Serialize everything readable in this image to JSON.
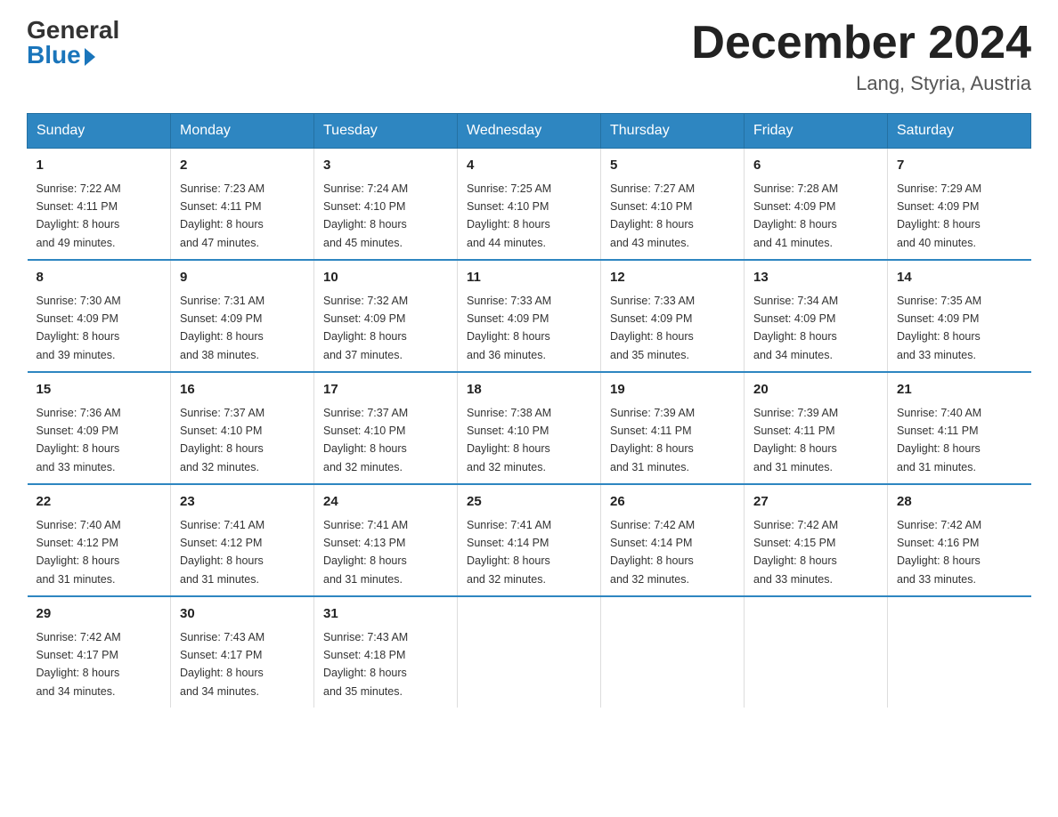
{
  "header": {
    "logo_general": "General",
    "logo_blue": "Blue",
    "month_title": "December 2024",
    "location": "Lang, Styria, Austria"
  },
  "days_of_week": [
    "Sunday",
    "Monday",
    "Tuesday",
    "Wednesday",
    "Thursday",
    "Friday",
    "Saturday"
  ],
  "weeks": [
    [
      {
        "day": "1",
        "sunrise": "7:22 AM",
        "sunset": "4:11 PM",
        "daylight": "8 hours and 49 minutes."
      },
      {
        "day": "2",
        "sunrise": "7:23 AM",
        "sunset": "4:11 PM",
        "daylight": "8 hours and 47 minutes."
      },
      {
        "day": "3",
        "sunrise": "7:24 AM",
        "sunset": "4:10 PM",
        "daylight": "8 hours and 45 minutes."
      },
      {
        "day": "4",
        "sunrise": "7:25 AM",
        "sunset": "4:10 PM",
        "daylight": "8 hours and 44 minutes."
      },
      {
        "day": "5",
        "sunrise": "7:27 AM",
        "sunset": "4:10 PM",
        "daylight": "8 hours and 43 minutes."
      },
      {
        "day": "6",
        "sunrise": "7:28 AM",
        "sunset": "4:09 PM",
        "daylight": "8 hours and 41 minutes."
      },
      {
        "day": "7",
        "sunrise": "7:29 AM",
        "sunset": "4:09 PM",
        "daylight": "8 hours and 40 minutes."
      }
    ],
    [
      {
        "day": "8",
        "sunrise": "7:30 AM",
        "sunset": "4:09 PM",
        "daylight": "8 hours and 39 minutes."
      },
      {
        "day": "9",
        "sunrise": "7:31 AM",
        "sunset": "4:09 PM",
        "daylight": "8 hours and 38 minutes."
      },
      {
        "day": "10",
        "sunrise": "7:32 AM",
        "sunset": "4:09 PM",
        "daylight": "8 hours and 37 minutes."
      },
      {
        "day": "11",
        "sunrise": "7:33 AM",
        "sunset": "4:09 PM",
        "daylight": "8 hours and 36 minutes."
      },
      {
        "day": "12",
        "sunrise": "7:33 AM",
        "sunset": "4:09 PM",
        "daylight": "8 hours and 35 minutes."
      },
      {
        "day": "13",
        "sunrise": "7:34 AM",
        "sunset": "4:09 PM",
        "daylight": "8 hours and 34 minutes."
      },
      {
        "day": "14",
        "sunrise": "7:35 AM",
        "sunset": "4:09 PM",
        "daylight": "8 hours and 33 minutes."
      }
    ],
    [
      {
        "day": "15",
        "sunrise": "7:36 AM",
        "sunset": "4:09 PM",
        "daylight": "8 hours and 33 minutes."
      },
      {
        "day": "16",
        "sunrise": "7:37 AM",
        "sunset": "4:10 PM",
        "daylight": "8 hours and 32 minutes."
      },
      {
        "day": "17",
        "sunrise": "7:37 AM",
        "sunset": "4:10 PM",
        "daylight": "8 hours and 32 minutes."
      },
      {
        "day": "18",
        "sunrise": "7:38 AM",
        "sunset": "4:10 PM",
        "daylight": "8 hours and 32 minutes."
      },
      {
        "day": "19",
        "sunrise": "7:39 AM",
        "sunset": "4:11 PM",
        "daylight": "8 hours and 31 minutes."
      },
      {
        "day": "20",
        "sunrise": "7:39 AM",
        "sunset": "4:11 PM",
        "daylight": "8 hours and 31 minutes."
      },
      {
        "day": "21",
        "sunrise": "7:40 AM",
        "sunset": "4:11 PM",
        "daylight": "8 hours and 31 minutes."
      }
    ],
    [
      {
        "day": "22",
        "sunrise": "7:40 AM",
        "sunset": "4:12 PM",
        "daylight": "8 hours and 31 minutes."
      },
      {
        "day": "23",
        "sunrise": "7:41 AM",
        "sunset": "4:12 PM",
        "daylight": "8 hours and 31 minutes."
      },
      {
        "day": "24",
        "sunrise": "7:41 AM",
        "sunset": "4:13 PM",
        "daylight": "8 hours and 31 minutes."
      },
      {
        "day": "25",
        "sunrise": "7:41 AM",
        "sunset": "4:14 PM",
        "daylight": "8 hours and 32 minutes."
      },
      {
        "day": "26",
        "sunrise": "7:42 AM",
        "sunset": "4:14 PM",
        "daylight": "8 hours and 32 minutes."
      },
      {
        "day": "27",
        "sunrise": "7:42 AM",
        "sunset": "4:15 PM",
        "daylight": "8 hours and 33 minutes."
      },
      {
        "day": "28",
        "sunrise": "7:42 AM",
        "sunset": "4:16 PM",
        "daylight": "8 hours and 33 minutes."
      }
    ],
    [
      {
        "day": "29",
        "sunrise": "7:42 AM",
        "sunset": "4:17 PM",
        "daylight": "8 hours and 34 minutes."
      },
      {
        "day": "30",
        "sunrise": "7:43 AM",
        "sunset": "4:17 PM",
        "daylight": "8 hours and 34 minutes."
      },
      {
        "day": "31",
        "sunrise": "7:43 AM",
        "sunset": "4:18 PM",
        "daylight": "8 hours and 35 minutes."
      },
      null,
      null,
      null,
      null
    ]
  ],
  "labels": {
    "sunrise": "Sunrise:",
    "sunset": "Sunset:",
    "daylight": "Daylight:"
  }
}
